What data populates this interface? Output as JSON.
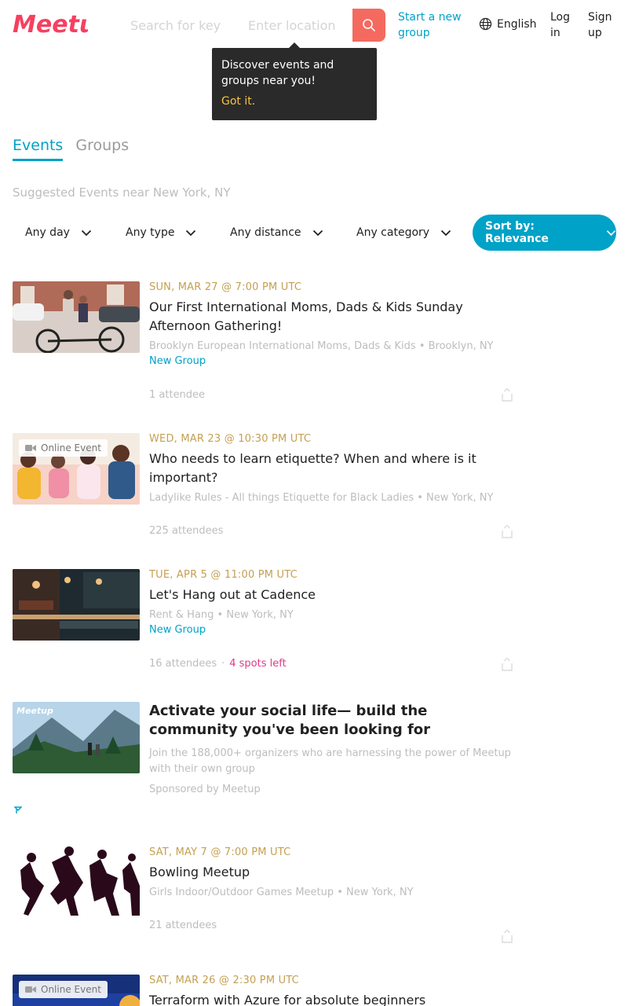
{
  "header": {
    "brand": "Meetup",
    "search_placeholder": "Search for key",
    "location_placeholder": "Enter location",
    "start_group": "Start a new group",
    "language": "English",
    "login": "Log in",
    "signup": "Sign up"
  },
  "tooltip": {
    "text": "Discover events and groups near you!",
    "button": "Got it."
  },
  "tabs": [
    {
      "label": "Events"
    },
    {
      "label": "Groups"
    }
  ],
  "subtitle": "Suggested Events near New York, NY",
  "filters": [
    {
      "label": "Any day"
    },
    {
      "label": "Any type"
    },
    {
      "label": "Any distance"
    },
    {
      "label": "Any category"
    }
  ],
  "sort_label": "Sort by: Relevance",
  "events": [
    {
      "date": "SUN, MAR 27 @ 7:00 PM UTC",
      "title": "Our First International Moms, Dads & Kids Sunday Afternoon Gathering!",
      "group": "Brooklyn European International Moms, Dads & Kids • Brooklyn, NY",
      "tag": "New Group",
      "attendees": "1 attendee"
    },
    {
      "date": "WED, MAR 23 @ 10:30 PM UTC",
      "title": "Who needs to learn etiquette? When and where is it important?",
      "group": "Ladylike Rules - All things Etiquette for Black Ladies • New York, NY",
      "badge": "Online Event",
      "attendees": "225 attendees"
    },
    {
      "date": "TUE, APR 5 @ 11:00 PM UTC",
      "title": "Let's Hang out at Cadence",
      "group": "Rent & Hang • New York, NY",
      "tag": "New Group",
      "attendees": "16 attendees",
      "sep": "·",
      "spots": "4 spots left"
    },
    {
      "date": "SAT, MAY 7 @ 7:00 PM UTC",
      "title": "Bowling Meetup",
      "group": "Girls Indoor/Outdoor Games Meetup • New York, NY",
      "attendees": "21 attendees"
    },
    {
      "date": "SAT, MAR 26 @ 2:30 PM UTC",
      "title": "Terraform with Azure for absolute beginners",
      "badge": "Online Event"
    }
  ],
  "promo": {
    "title": "Activate your social life— build the community you've been looking for",
    "text": "Join the 188,000+ organizers who are harnessing the power of Meetup with their own group",
    "sponsor": "Sponsored by Meetup",
    "thumb_logo": "Meetup"
  },
  "colors": {
    "brand": "#f64060",
    "accent": "#00a2c7",
    "date": "#c4a052",
    "spots": "#e0398a",
    "search_button": "#f46a5f"
  }
}
